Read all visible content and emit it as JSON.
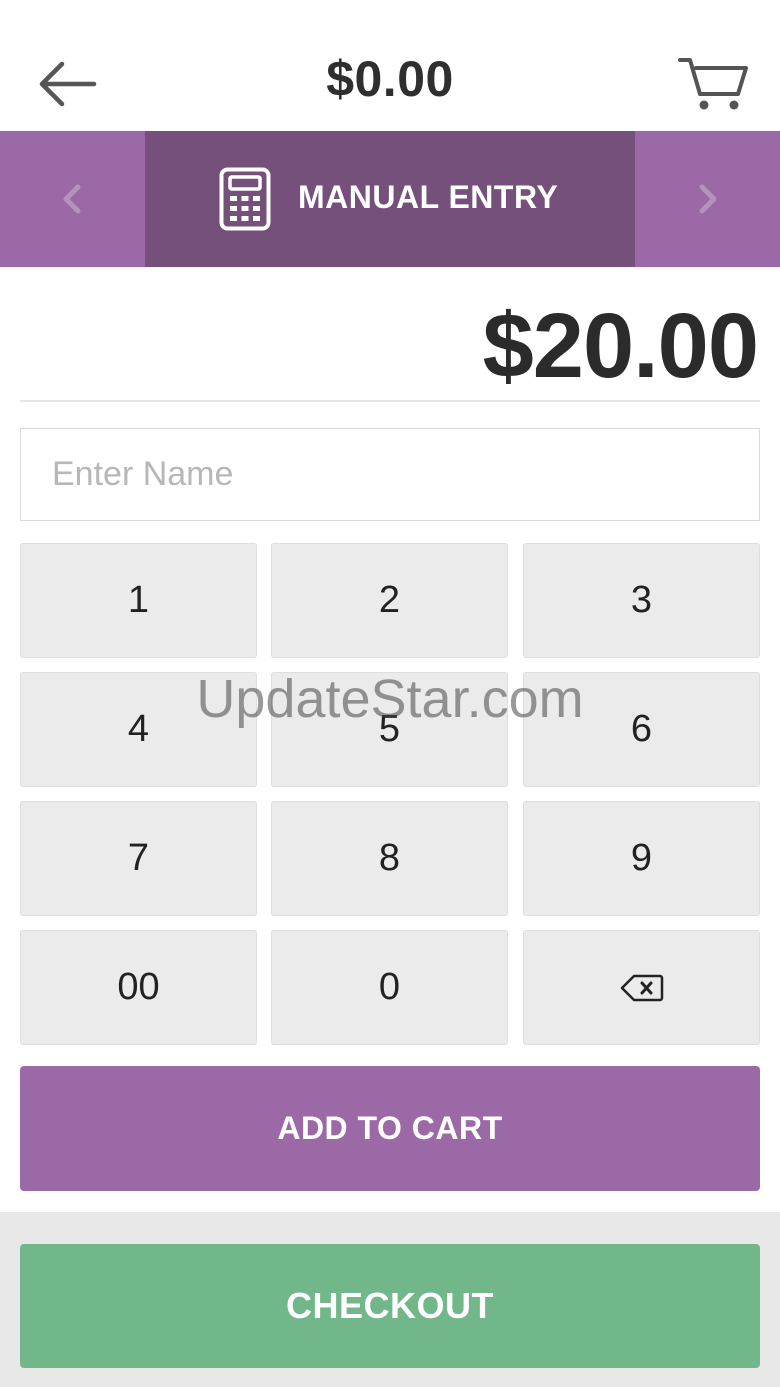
{
  "header": {
    "total": "$0.00",
    "back_icon": "arrow-left-icon",
    "cart_icon": "shopping-cart-icon"
  },
  "modebar": {
    "label": "MANUAL ENTRY",
    "icon": "calculator-icon",
    "prev_icon": "chevron-left-icon",
    "next_icon": "chevron-right-icon"
  },
  "amount": "$20.00",
  "name_field": {
    "placeholder": "Enter Name",
    "value": ""
  },
  "keypad": {
    "k1": "1",
    "k2": "2",
    "k3": "3",
    "k4": "4",
    "k5": "5",
    "k6": "6",
    "k7": "7",
    "k8": "8",
    "k9": "9",
    "k00": "00",
    "k0": "0",
    "backspace_icon": "backspace-icon"
  },
  "add_to_cart_label": "ADD TO CART",
  "checkout_label": "CHECKOUT",
  "watermark": "UpdateStar.com",
  "colors": {
    "purple": "#9a69a6",
    "purple_dark": "#74507b",
    "green": "#71b78a",
    "key_bg": "#ebebeb"
  }
}
